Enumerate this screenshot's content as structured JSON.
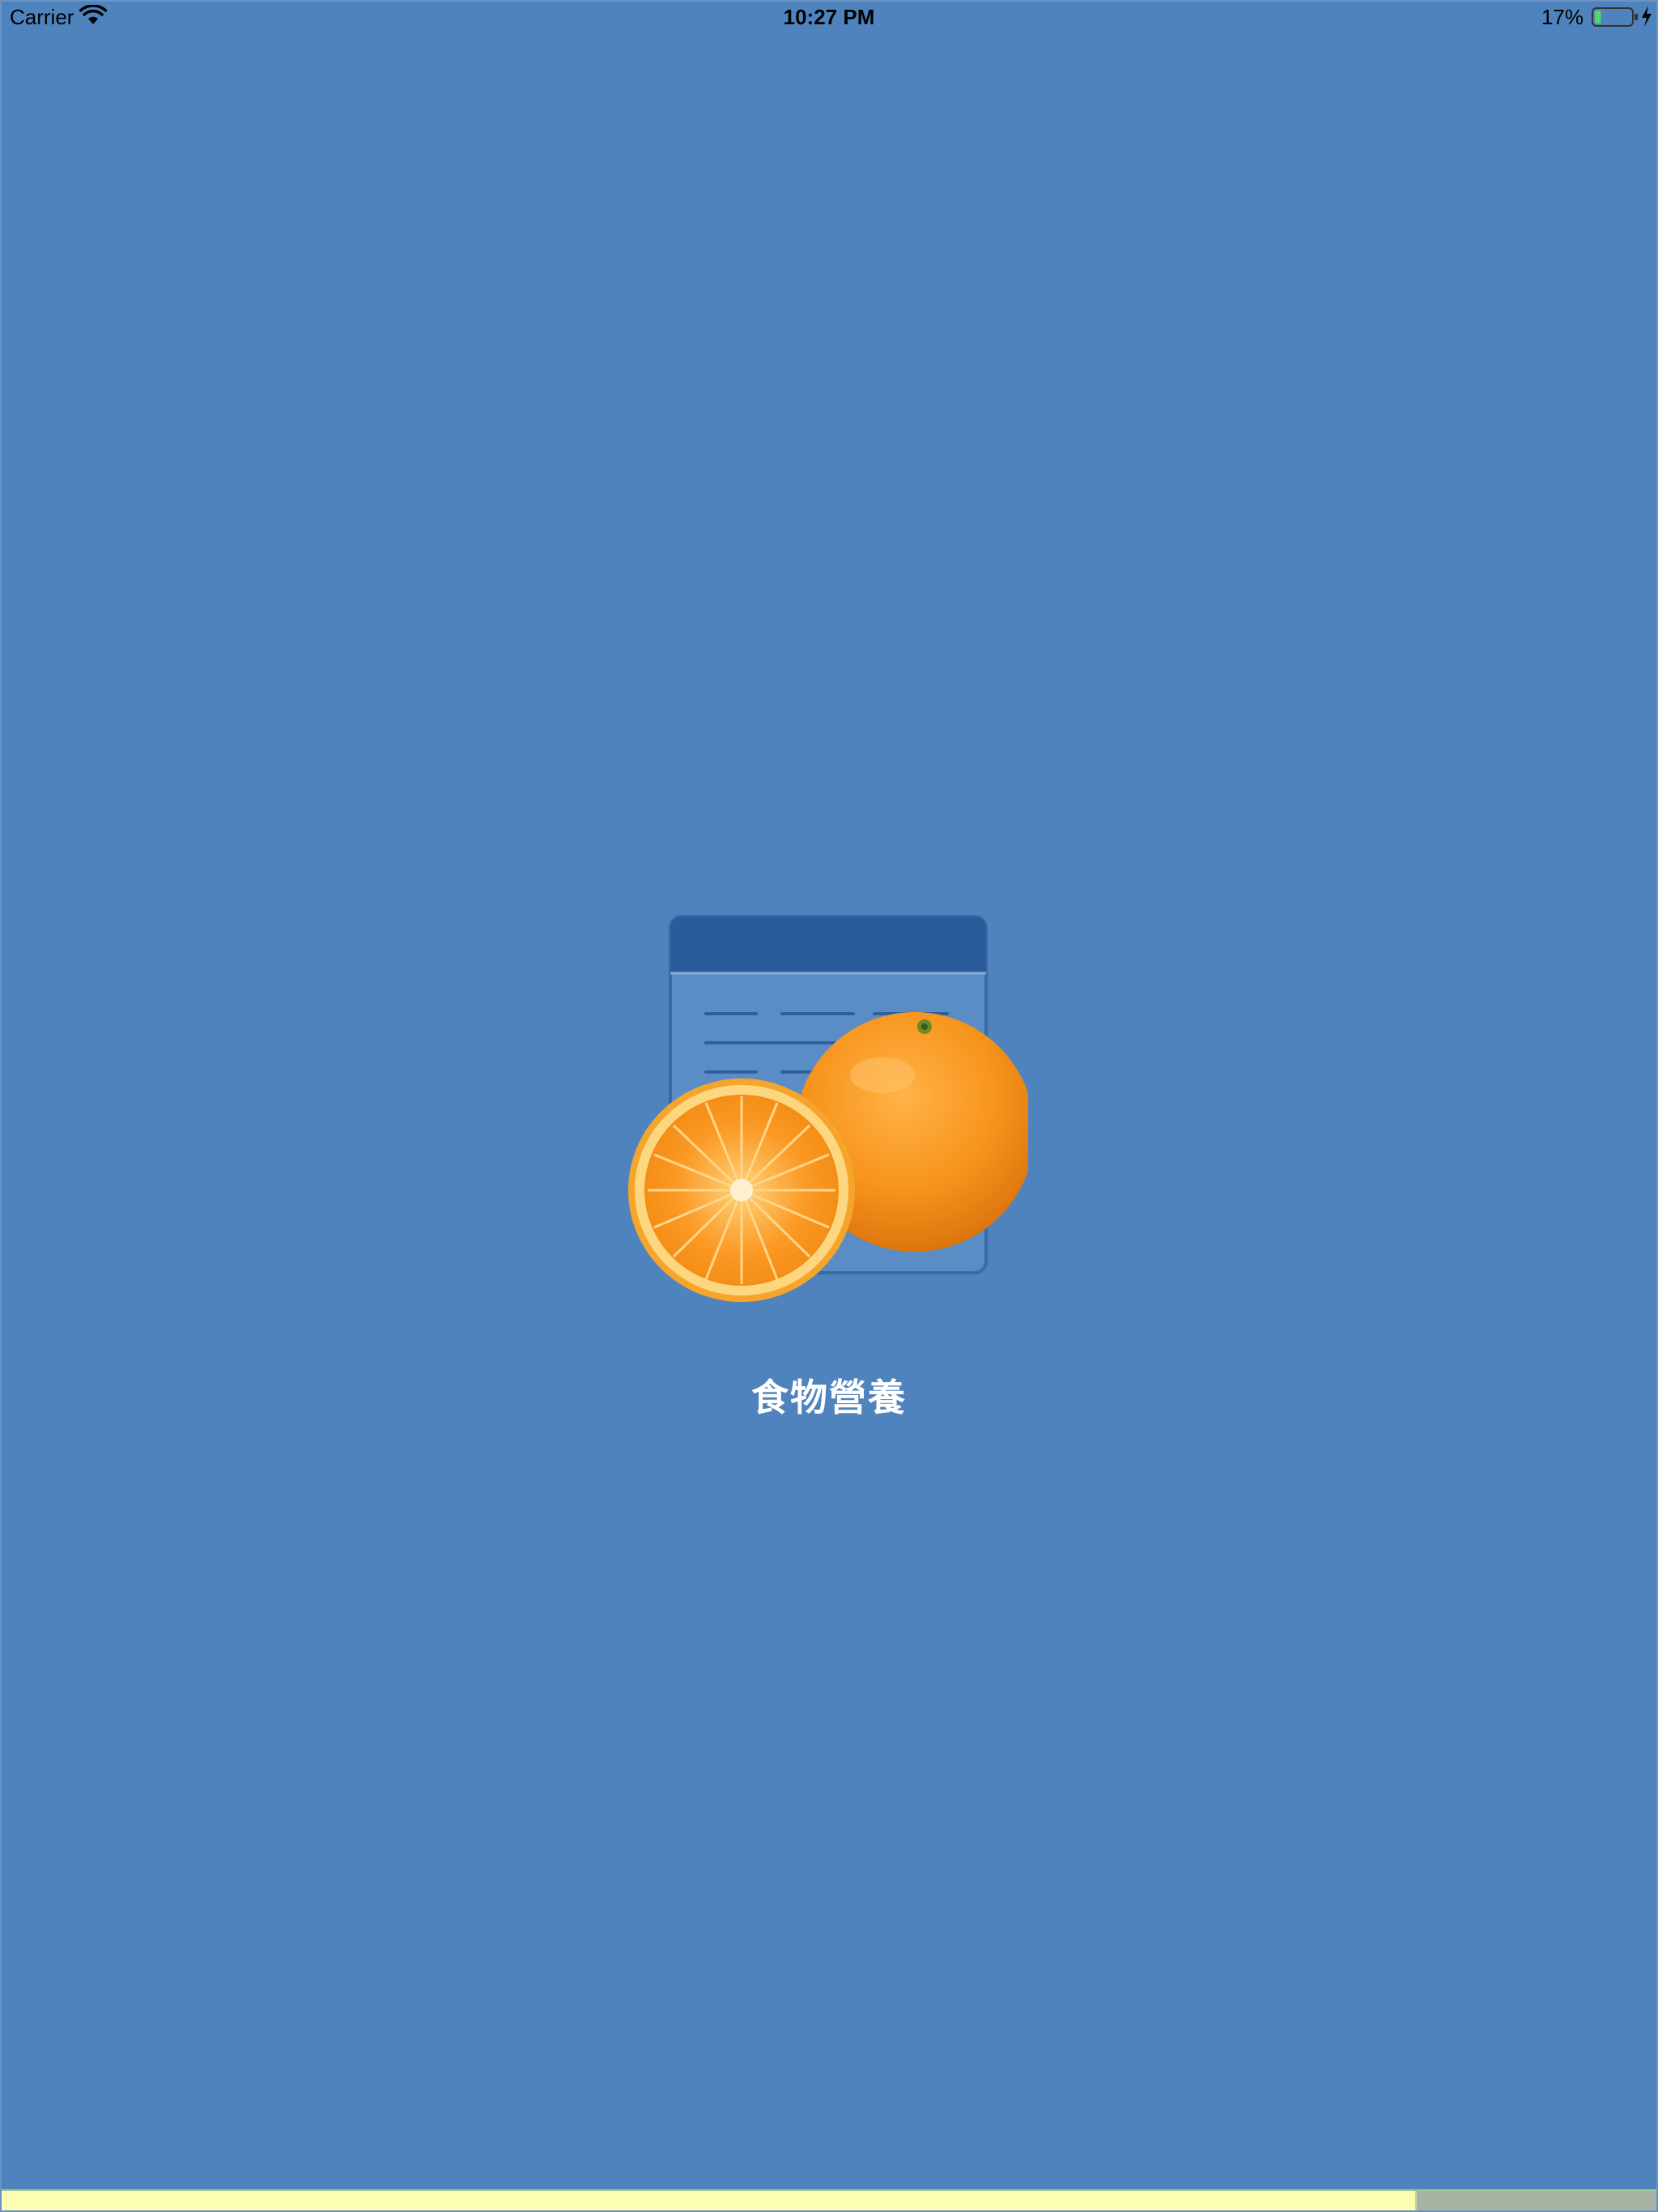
{
  "status_bar": {
    "carrier": "Carrier",
    "time": "10:27 PM",
    "battery_percent": "17%",
    "battery_level": 0.17,
    "charging": true,
    "icons": [
      "wifi-icon",
      "battery-icon",
      "charging-bolt-icon"
    ]
  },
  "splash": {
    "logo_icon": "orange-nutrition-table-icon",
    "app_title": "食物營養"
  },
  "loading": {
    "progress": 0.855,
    "fill_color": "#fbfdb0",
    "track_color": "#a9b3a3"
  },
  "colors": {
    "background": "#4f83be",
    "table_header": "#2a5c9c",
    "orange": "#f7941d"
  }
}
